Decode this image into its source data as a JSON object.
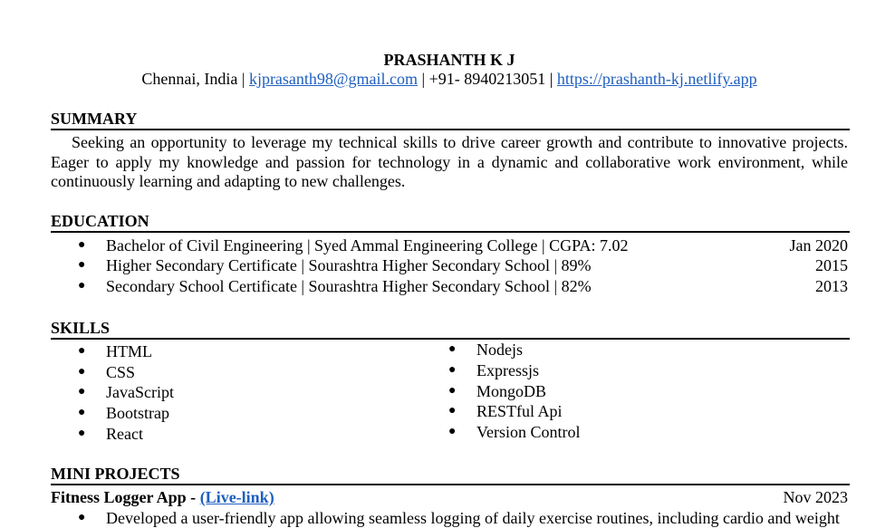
{
  "header": {
    "name": "PRASHANTH K J",
    "location": "Chennai, India",
    "separator": " | ",
    "email": "kjprasanth98@gmail.com",
    "phone": "+91- 8940213051",
    "website": "https://prashanth-kj.netlify.app"
  },
  "summary": {
    "heading": "SUMMARY",
    "text": "Seeking an opportunity to leverage my technical skills to drive career growth and contribute to innovative projects. Eager to apply my knowledge and passion for technology in a dynamic and collaborative work environment, while continuously learning and adapting to new challenges."
  },
  "education": {
    "heading": "EDUCATION",
    "items": [
      {
        "text": "Bachelor of Civil Engineering | Syed Ammal Engineering College | CGPA: 7.02",
        "date": "Jan 2020"
      },
      {
        "text": "Higher Secondary Certificate | Sourashtra Higher Secondary School | 89%",
        "date": "2015"
      },
      {
        "text": "Secondary School Certificate | Sourashtra Higher Secondary School | 82%",
        "date": "2013"
      }
    ]
  },
  "skills": {
    "heading": "SKILLS",
    "bullet": "●",
    "left": [
      "HTML",
      "CSS",
      "JavaScript",
      "Bootstrap",
      "React"
    ],
    "right": [
      "Nodejs",
      "Expressjs",
      "MongoDB",
      "RESTful Api",
      "Version Control"
    ]
  },
  "projects": {
    "heading": "MINI PROJECTS",
    "items": [
      {
        "title": "Fitness Logger App - ",
        "link": "(Live-link)",
        "date": "Nov 2023",
        "points": [
          "Developed a user-friendly app allowing seamless logging of daily exercise routines, including cardio and weight"
        ]
      }
    ]
  }
}
